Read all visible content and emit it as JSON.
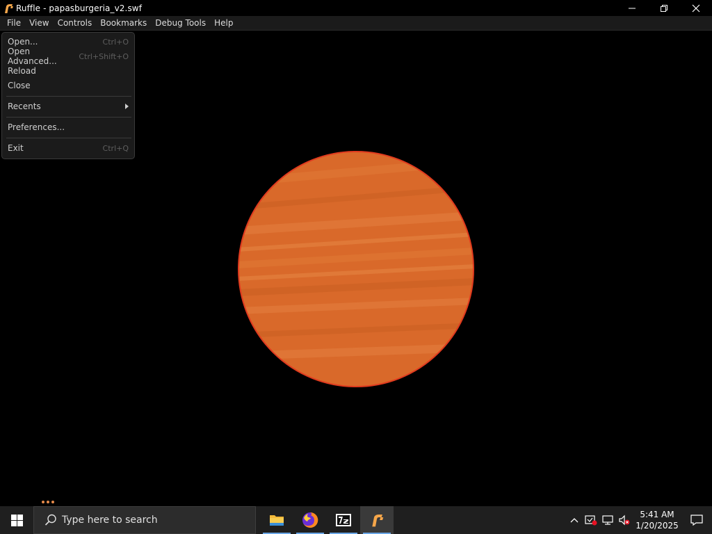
{
  "window": {
    "title": "Ruffle - papasburgeria_v2.swf"
  },
  "menubar": {
    "items": [
      "File",
      "View",
      "Controls",
      "Bookmarks",
      "Debug Tools",
      "Help"
    ]
  },
  "file_menu": {
    "open": {
      "label": "Open...",
      "shortcut": "Ctrl+O"
    },
    "open_advanced": {
      "label": "Open Advanced...",
      "shortcut": "Ctrl+Shift+O"
    },
    "reload": {
      "label": "Reload"
    },
    "close": {
      "label": "Close"
    },
    "recents": {
      "label": "Recents"
    },
    "preferences": {
      "label": "Preferences..."
    },
    "exit": {
      "label": "Exit",
      "shortcut": "Ctrl+Q"
    }
  },
  "taskbar": {
    "search_placeholder": "Type here to search",
    "apps": [
      "file-explorer-icon",
      "firefox-icon",
      "7zip-icon",
      "ruffle-icon"
    ],
    "active_app": "ruffle-icon"
  },
  "tray": {
    "time": "5:41 AM",
    "date": "1/20/2025"
  },
  "colors": {
    "accent_orange": "#d9692a",
    "ball_outline": "#e03a1e",
    "taskbar_active_underline": "#6aa6e6"
  }
}
